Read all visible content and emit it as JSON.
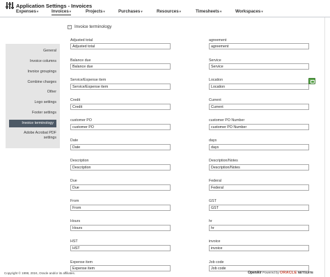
{
  "header": {
    "title": "Application Settings - Invoices"
  },
  "nav": {
    "items": [
      {
        "label": "Expenses"
      },
      {
        "label": "Invoices"
      },
      {
        "label": "Projects"
      },
      {
        "label": "Purchases"
      },
      {
        "label": "Resources"
      },
      {
        "label": "Timesheets"
      },
      {
        "label": "Workspaces"
      }
    ],
    "caret": "▾"
  },
  "sidebar": {
    "items": [
      {
        "label": "General"
      },
      {
        "label": "Invoice columns"
      },
      {
        "label": "Invoice groupings"
      },
      {
        "label": "Combine charges"
      },
      {
        "label": "Other"
      },
      {
        "label": "Logo settings"
      },
      {
        "label": "Footer settings"
      },
      {
        "label": "Invoice terminology"
      },
      {
        "label": "Adobe Acrobat PDF settings"
      }
    ],
    "active_index": 7
  },
  "section": {
    "toggle": "−",
    "title": "Invoice terminology"
  },
  "fields_left": [
    {
      "label": "Adjusted total",
      "value": "Adjusted total"
    },
    {
      "label": "Balance due",
      "value": "Balance due"
    },
    {
      "label": "Service/Expense item",
      "value": "Service/Expense item"
    },
    {
      "label": "Credit",
      "value": "Credit"
    },
    {
      "label": "customer PO",
      "value": "customer PO"
    },
    {
      "label": "Date",
      "value": "Date"
    },
    {
      "label": "Description",
      "value": "Description"
    },
    {
      "label": "Due",
      "value": "Due"
    },
    {
      "label": "From",
      "value": "From"
    },
    {
      "label": "Hours",
      "value": "Hours"
    },
    {
      "label": "HST",
      "value": "HST"
    },
    {
      "label": "Expense item",
      "value": "Expense item"
    }
  ],
  "fields_right": [
    {
      "label": "agreement",
      "value": "agreement"
    },
    {
      "label": "Service",
      "value": "Service"
    },
    {
      "label": "Location",
      "value": "Location"
    },
    {
      "label": "Current",
      "value": "Current"
    },
    {
      "label": "customer PO Number",
      "value": "customer PO Number"
    },
    {
      "label": "days",
      "value": "days"
    },
    {
      "label": "Description/Notes",
      "value": "Description/Notes"
    },
    {
      "label": "Federal",
      "value": "Federal"
    },
    {
      "label": "GST",
      "value": "GST"
    },
    {
      "label": "hr",
      "value": "hr"
    },
    {
      "label": "invoice",
      "value": "invoice"
    },
    {
      "label": "Job code",
      "value": "Job code"
    }
  ],
  "footer": {
    "copyright": "Copyright © 1998, 2024, Oracle and/or its affiliates.",
    "openair": "OpenAir",
    "powered_by": "Powered by",
    "oracle": "ORACLE",
    "netsuite": "NETSUITE"
  },
  "colors": {
    "active_sidebar_bg": "#4d5966",
    "sidebar_bg": "#e5e5e5",
    "add_button": "#59a34a"
  }
}
